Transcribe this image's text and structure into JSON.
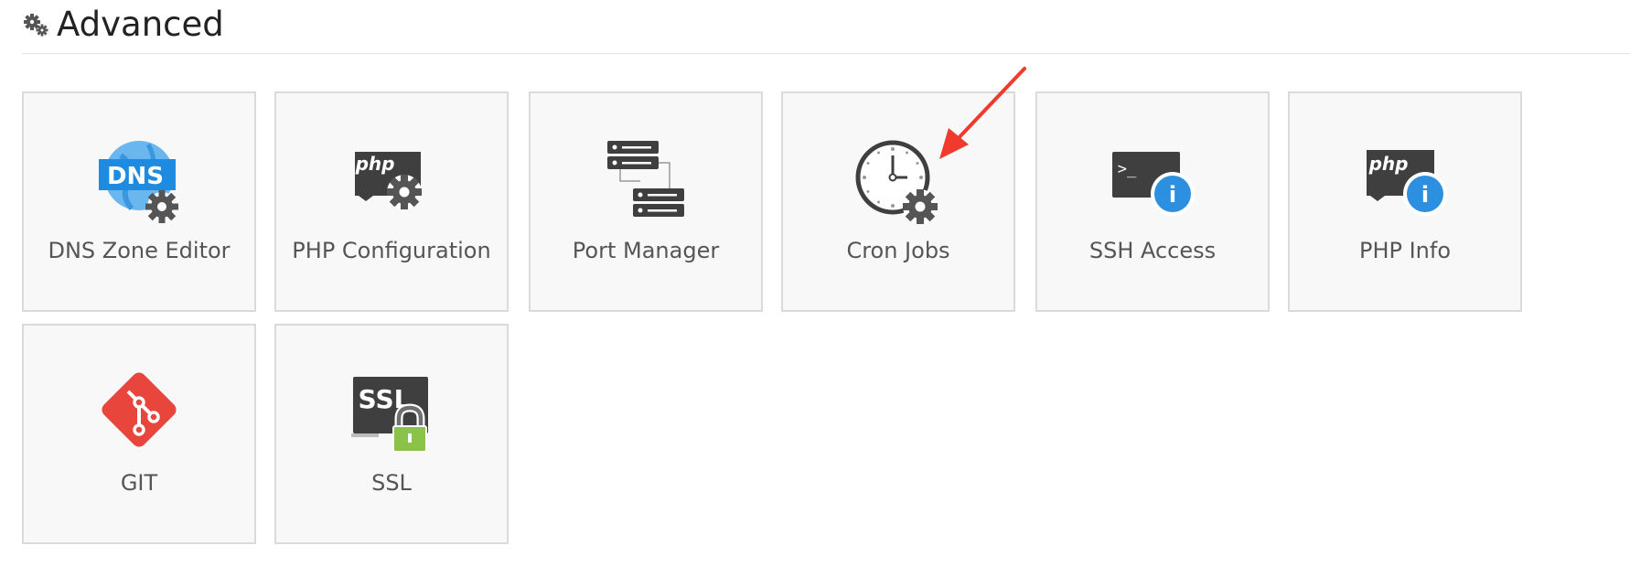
{
  "section": {
    "title": "Advanced",
    "icon": "gears-icon"
  },
  "tiles": [
    {
      "label": "DNS Zone Editor",
      "icon": "dns-zone-editor-icon"
    },
    {
      "label": "PHP Configuration",
      "icon": "php-configuration-icon"
    },
    {
      "label": "Port Manager",
      "icon": "port-manager-icon"
    },
    {
      "label": "Cron Jobs",
      "icon": "cron-jobs-icon"
    },
    {
      "label": "SSH Access",
      "icon": "ssh-access-icon"
    },
    {
      "label": "PHP Info",
      "icon": "php-info-icon"
    },
    {
      "label": "GIT",
      "icon": "git-icon"
    },
    {
      "label": "SSL",
      "icon": "ssl-icon"
    }
  ],
  "icon_text": {
    "dns": "DNS",
    "php": "php",
    "terminal_prompt": ">_",
    "info": "i",
    "ssl": "SSL"
  },
  "colors": {
    "accent_blue": "#2d8fe0",
    "git_red": "#e8453c",
    "lock_green": "#8bc34a",
    "dark_gray": "#3f3f3f",
    "annotation_red": "#f03a2e"
  }
}
